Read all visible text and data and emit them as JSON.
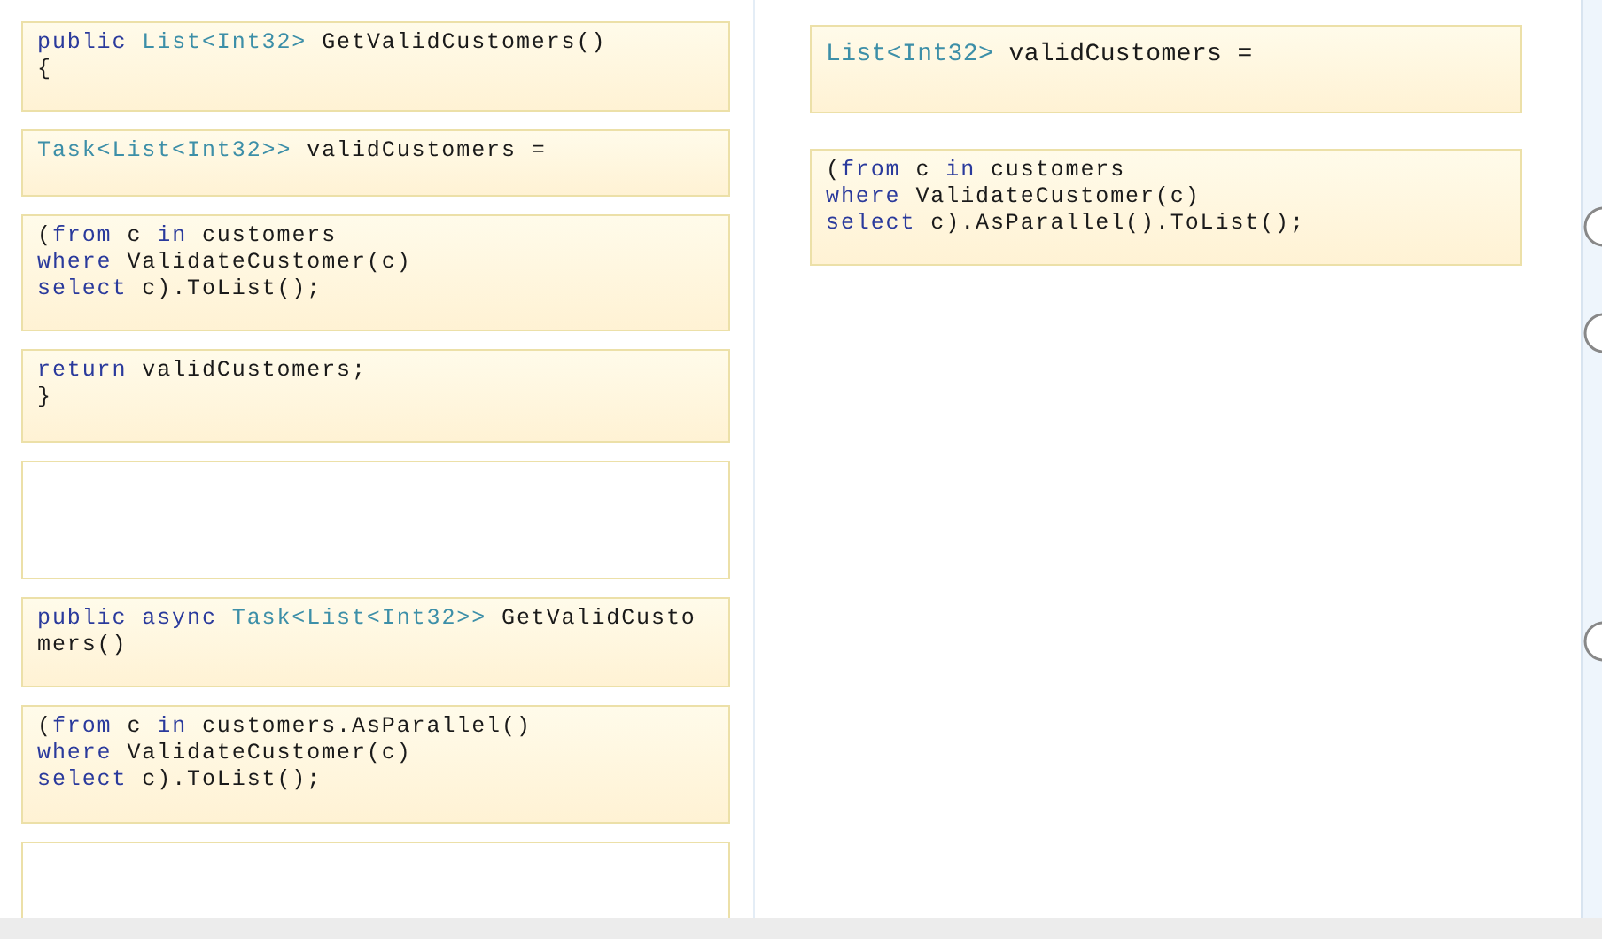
{
  "source_tiles": [
    {
      "kind": "code",
      "lines": [
        [
          {
            "kind": "keyword",
            "text": "public "
          },
          {
            "kind": "type",
            "text": "List<Int32>"
          },
          {
            "kind": "plain",
            "text": " GetValidCustomers()"
          }
        ],
        [
          {
            "kind": "plain",
            "text": "{"
          }
        ]
      ]
    },
    {
      "kind": "code",
      "lines": [
        [
          {
            "kind": "type",
            "text": "Task<List<Int32>>"
          },
          {
            "kind": "plain",
            "text": " validCustomers ="
          }
        ]
      ]
    },
    {
      "kind": "code",
      "lines": [
        [
          {
            "kind": "plain",
            "text": "("
          },
          {
            "kind": "keyword",
            "text": "from"
          },
          {
            "kind": "plain",
            "text": " c "
          },
          {
            "kind": "keyword",
            "text": "in"
          },
          {
            "kind": "plain",
            "text": " customers"
          }
        ],
        [
          {
            "kind": "keyword",
            "text": "where"
          },
          {
            "kind": "plain",
            "text": " ValidateCustomer(c)"
          }
        ],
        [
          {
            "kind": "keyword",
            "text": "select"
          },
          {
            "kind": "plain",
            "text": " c).ToList();"
          }
        ]
      ]
    },
    {
      "kind": "code",
      "lines": [
        [
          {
            "kind": "keyword",
            "text": "return"
          },
          {
            "kind": "plain",
            "text": " validCustomers;"
          }
        ],
        [
          {
            "kind": "plain",
            "text": "}"
          }
        ]
      ]
    },
    {
      "kind": "blank"
    },
    {
      "kind": "code",
      "lines": [
        [
          {
            "kind": "keyword",
            "text": "public async "
          },
          {
            "kind": "type",
            "text": "Task<List<Int32>>"
          },
          {
            "kind": "plain",
            "text": " GetValidCusto"
          }
        ],
        [
          {
            "kind": "plain",
            "text": "mers()"
          }
        ]
      ]
    },
    {
      "kind": "code",
      "lines": [
        [
          {
            "kind": "plain",
            "text": "("
          },
          {
            "kind": "keyword",
            "text": "from"
          },
          {
            "kind": "plain",
            "text": " c "
          },
          {
            "kind": "keyword",
            "text": "in"
          },
          {
            "kind": "plain",
            "text": " customers.AsParallel()"
          }
        ],
        [
          {
            "kind": "keyword",
            "text": "where"
          },
          {
            "kind": "plain",
            "text": " ValidateCustomer(c)"
          }
        ],
        [
          {
            "kind": "keyword",
            "text": "select"
          },
          {
            "kind": "plain",
            "text": " c).ToList();"
          }
        ]
      ]
    },
    {
      "kind": "blank"
    }
  ],
  "answer_tiles": [
    {
      "kind": "code",
      "lines": [
        [
          {
            "kind": "type",
            "text": "List<Int32>"
          },
          {
            "kind": "plain",
            "text": " validCustomers ="
          }
        ]
      ]
    },
    {
      "kind": "code",
      "lines": [
        [
          {
            "kind": "plain",
            "text": "("
          },
          {
            "kind": "keyword",
            "text": "from"
          },
          {
            "kind": "plain",
            "text": " c "
          },
          {
            "kind": "keyword",
            "text": "in"
          },
          {
            "kind": "plain",
            "text": " customers"
          }
        ],
        [
          {
            "kind": "keyword",
            "text": "where"
          },
          {
            "kind": "plain",
            "text": " ValidateCustomer(c)"
          }
        ],
        [
          {
            "kind": "keyword",
            "text": "select"
          },
          {
            "kind": "plain",
            "text": " c).AsParallel().ToList();"
          }
        ]
      ]
    }
  ],
  "radio_buttons": [
    {
      "selected": false
    },
    {
      "selected": false
    },
    {
      "selected": false
    }
  ]
}
